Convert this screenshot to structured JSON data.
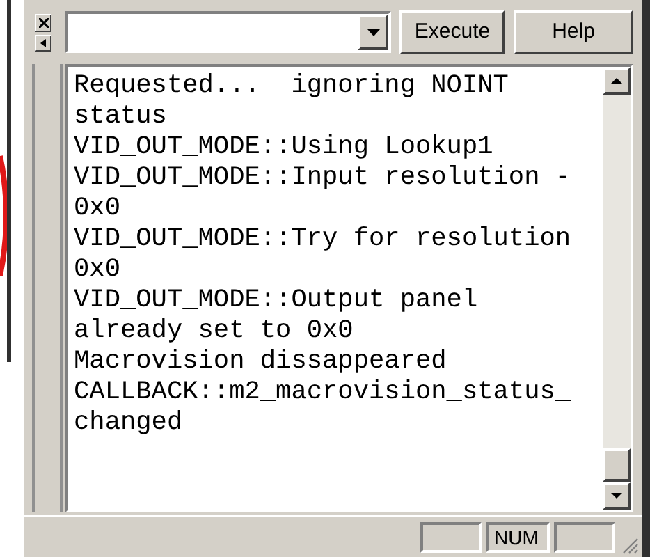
{
  "toolbar": {
    "buttons": [
      {
        "label": "Execute"
      },
      {
        "label": "Help"
      }
    ]
  },
  "output": {
    "lines": [
      "Requested...  ignoring NOINT",
      "status",
      "VID_OUT_MODE::Using Lookup1",
      "VID_OUT_MODE::Input resolution -",
      "0x0",
      "VID_OUT_MODE::Try for resolution",
      "0x0",
      "VID_OUT_MODE::Output panel",
      "already set to 0x0",
      "Macrovision dissappeared",
      "CALLBACK::m2_macrovision_status_",
      "changed"
    ]
  },
  "status_bar": {
    "panels": [
      {
        "kind": "blank"
      },
      {
        "kind": "text",
        "label": "NUM"
      },
      {
        "kind": "blank"
      }
    ]
  }
}
